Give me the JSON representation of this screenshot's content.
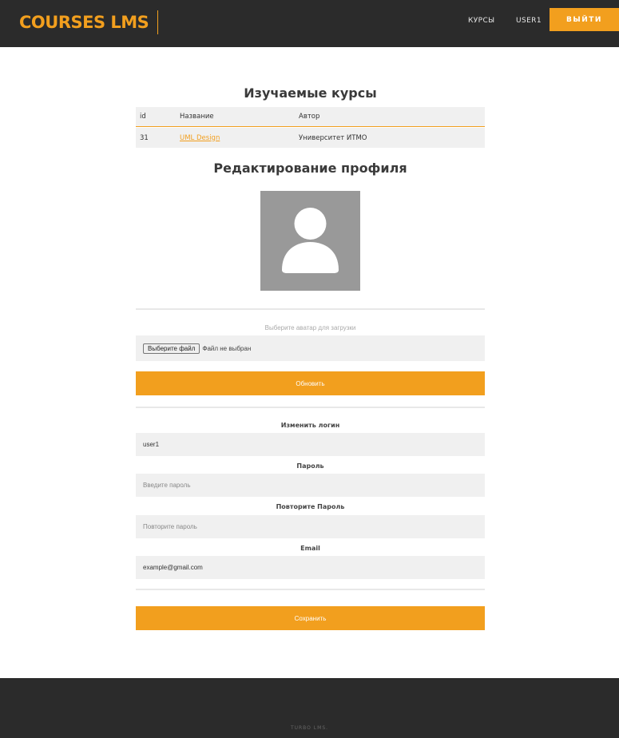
{
  "header": {
    "logo": "COURSES LMS",
    "nav": {
      "courses": "КУРСЫ",
      "user": "USER1",
      "logout": "ВЫЙТИ"
    }
  },
  "courses_section": {
    "title": "Изучаемые курсы",
    "columns": [
      "id",
      "Название",
      "Автор"
    ],
    "rows": [
      {
        "id": "31",
        "name": "UML Design",
        "author": "Университет ИТМО"
      }
    ]
  },
  "profile_section": {
    "title": "Редактирование профиля",
    "avatar_icon": "user-silhouette-icon",
    "upload_label": "Выберите аватар для загрузки",
    "file_button": "Выберите файл",
    "file_status": "Файл не выбран",
    "update_button": "Обновить"
  },
  "form": {
    "login_label": "Изменить логин",
    "login_value": "user1",
    "password_label": "Пароль",
    "password_placeholder": "Введите пароль",
    "repeat_label": "Повторите Пароль",
    "repeat_placeholder": "Повторите пароль",
    "email_label": "Email",
    "email_value": "example@gmail.com",
    "save_button": "Сохранить"
  },
  "footer": {
    "text": "TURBO LMS."
  },
  "colors": {
    "accent": "#f29f1e",
    "header_bg": "#2b2b2b",
    "field_bg": "#f0f0f0",
    "avatar_bg": "#999999"
  }
}
